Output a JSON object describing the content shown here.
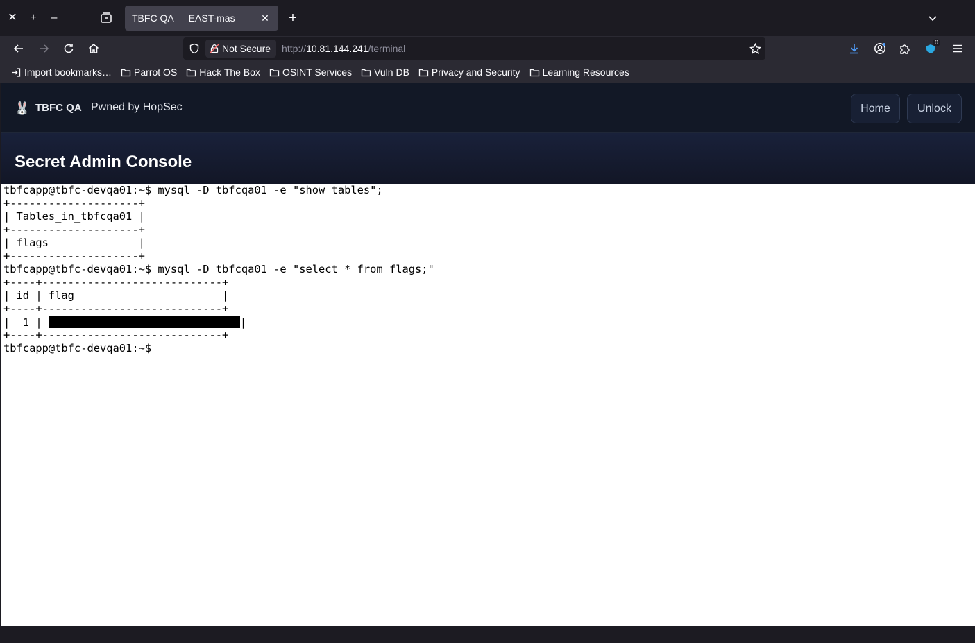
{
  "tab": {
    "title": "TBFC QA — EAST-mas",
    "close": "✕"
  },
  "tabbar": {
    "close_window": "✕",
    "new_window": "+",
    "minimize": "–",
    "new_tab": "+"
  },
  "urlbar": {
    "security_label": "Not Secure",
    "url_prefix": "http://",
    "url_host": "10.81.144.241",
    "url_path": "/terminal"
  },
  "toolbar": {
    "notification_count": "0"
  },
  "bookmarks": [
    {
      "label": "Import bookmarks…",
      "icon": "import-icon"
    },
    {
      "label": "Parrot OS",
      "icon": "folder-icon"
    },
    {
      "label": "Hack The Box",
      "icon": "folder-icon"
    },
    {
      "label": "OSINT Services",
      "icon": "folder-icon"
    },
    {
      "label": "Vuln DB",
      "icon": "folder-icon"
    },
    {
      "label": "Privacy and Security",
      "icon": "folder-icon"
    },
    {
      "label": "Learning Resources",
      "icon": "folder-icon"
    }
  ],
  "site": {
    "logo": "🐰",
    "brand": "TBFC QA",
    "tagline": "Pwned by HopSec",
    "nav": {
      "home": "Home",
      "unlock": "Unlock"
    },
    "page_title": "Secret Admin Console"
  },
  "terminal": {
    "lines": [
      "tbfcapp@tbfc-devqa01:~$ mysql -D tbfcqa01 -e \"show tables\";",
      "+--------------------+",
      "| Tables_in_tbfcqa01 |",
      "+--------------------+",
      "| flags              |",
      "+--------------------+",
      "tbfcapp@tbfc-devqa01:~$ mysql -D tbfcqa01 -e \"select * from flags;\"",
      "+----+----------------------------+",
      "| id | flag                       |",
      "+----+----------------------------+"
    ],
    "row_prefix": "|  1 | ",
    "row_suffix": "|",
    "after_lines": [
      "+----+----------------------------+",
      "tbfcapp@tbfc-devqa01:~$"
    ]
  },
  "colors": {
    "chrome_bg": "#1c1b22",
    "toolbar_bg": "#2b2a33",
    "header_bg": "#121826",
    "accent": "#00ddff"
  }
}
